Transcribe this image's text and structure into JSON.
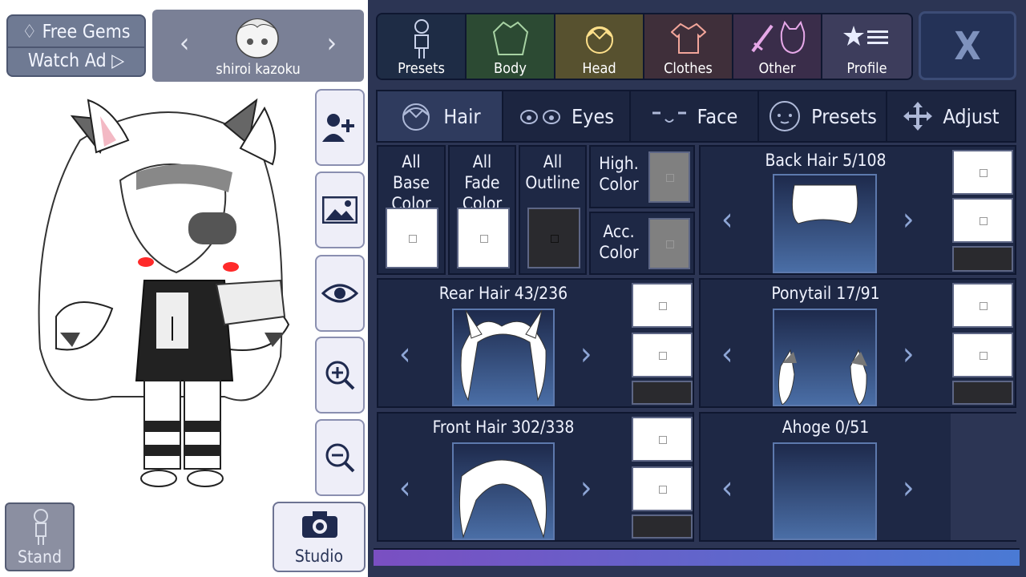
{
  "top_left": {
    "free_gems": "Free Gems",
    "watch_ad": "Watch Ad ▷"
  },
  "character": {
    "name": "shiroi kazoku"
  },
  "side_buttons": [
    "add-character",
    "background",
    "visibility",
    "zoom-in",
    "zoom-out"
  ],
  "bottom": {
    "stand": "Stand",
    "studio": "Studio"
  },
  "main_tabs": [
    {
      "label": "Presets",
      "color": "#1e2c45"
    },
    {
      "label": "Body",
      "color": "#2c4a33"
    },
    {
      "label": "Head",
      "color": "#57512f"
    },
    {
      "label": "Clothes",
      "color": "#3f2f3a"
    },
    {
      "label": "Other",
      "color": "#3a2d4a"
    },
    {
      "label": "Profile",
      "color": "#3d3d5c"
    }
  ],
  "close_label": "X",
  "sub_tabs": [
    {
      "label": "Hair"
    },
    {
      "label": "Eyes"
    },
    {
      "label": "Face"
    },
    {
      "label": "Presets"
    },
    {
      "label": "Adjust"
    }
  ],
  "colors": {
    "all_base": "All Base Color",
    "all_fade": "All Fade Color",
    "all_outline": "All Outline",
    "high_color": "High. Color",
    "acc_color": "Acc. Color"
  },
  "parts": {
    "back_hair": "Back Hair 5/108",
    "rear_hair": "Rear Hair 43/236",
    "ponytail": "Ponytail 17/91",
    "front_hair": "Front Hair 302/338",
    "ahoge": "Ahoge 0/51"
  }
}
